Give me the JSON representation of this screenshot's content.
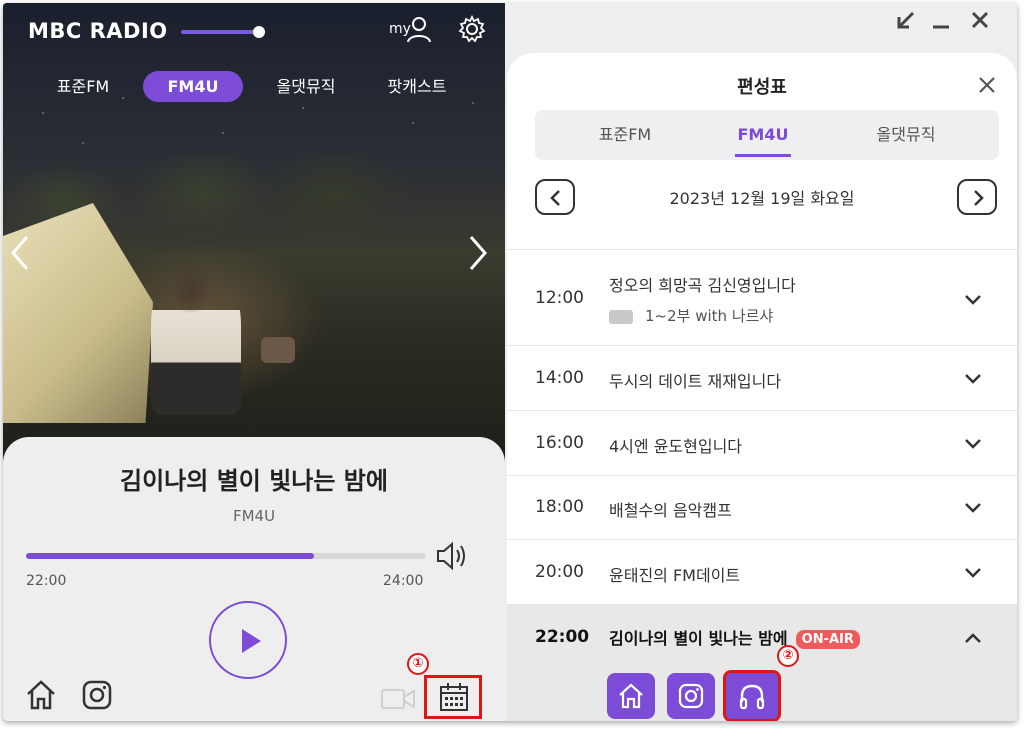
{
  "player": {
    "logo": "MBC RADIO",
    "my_label": "my",
    "tabs": [
      "표준FM",
      "FM4U",
      "올댓뮤직",
      "팟캐스트"
    ],
    "active_tab": "FM4U",
    "volume": 0.9,
    "now_title": "김이나의 별이 빛나는 밤에",
    "now_channel": "FM4U",
    "progress": 0.72,
    "time_start": "22:00",
    "time_end": "24:00",
    "marker": "①"
  },
  "schedule": {
    "title": "편성표",
    "tabs": [
      "표준FM",
      "FM4U",
      "올댓뮤직"
    ],
    "active_tab": "FM4U",
    "date": "2023년 12월 19일 화요일",
    "onair_badge": "ON-AIR",
    "marker": "②",
    "rows": [
      {
        "time": "12:00",
        "program": "정오의 희망곡 김신영입니다",
        "sub": "1~2부 with 나르샤"
      },
      {
        "time": "14:00",
        "program": "두시의 데이트 재재입니다"
      },
      {
        "time": "16:00",
        "program": "4시엔 윤도현입니다"
      },
      {
        "time": "18:00",
        "program": "배철수의 음악캠프"
      },
      {
        "time": "20:00",
        "program": "윤태진의 FM데이트"
      },
      {
        "time": "22:00",
        "program": "김이나의 별이 빛나는 밤에",
        "on_air": true
      }
    ]
  },
  "colors": {
    "accent": "#7c4cd6",
    "highlight": "#e01515",
    "onair": "#ee5b5b"
  }
}
